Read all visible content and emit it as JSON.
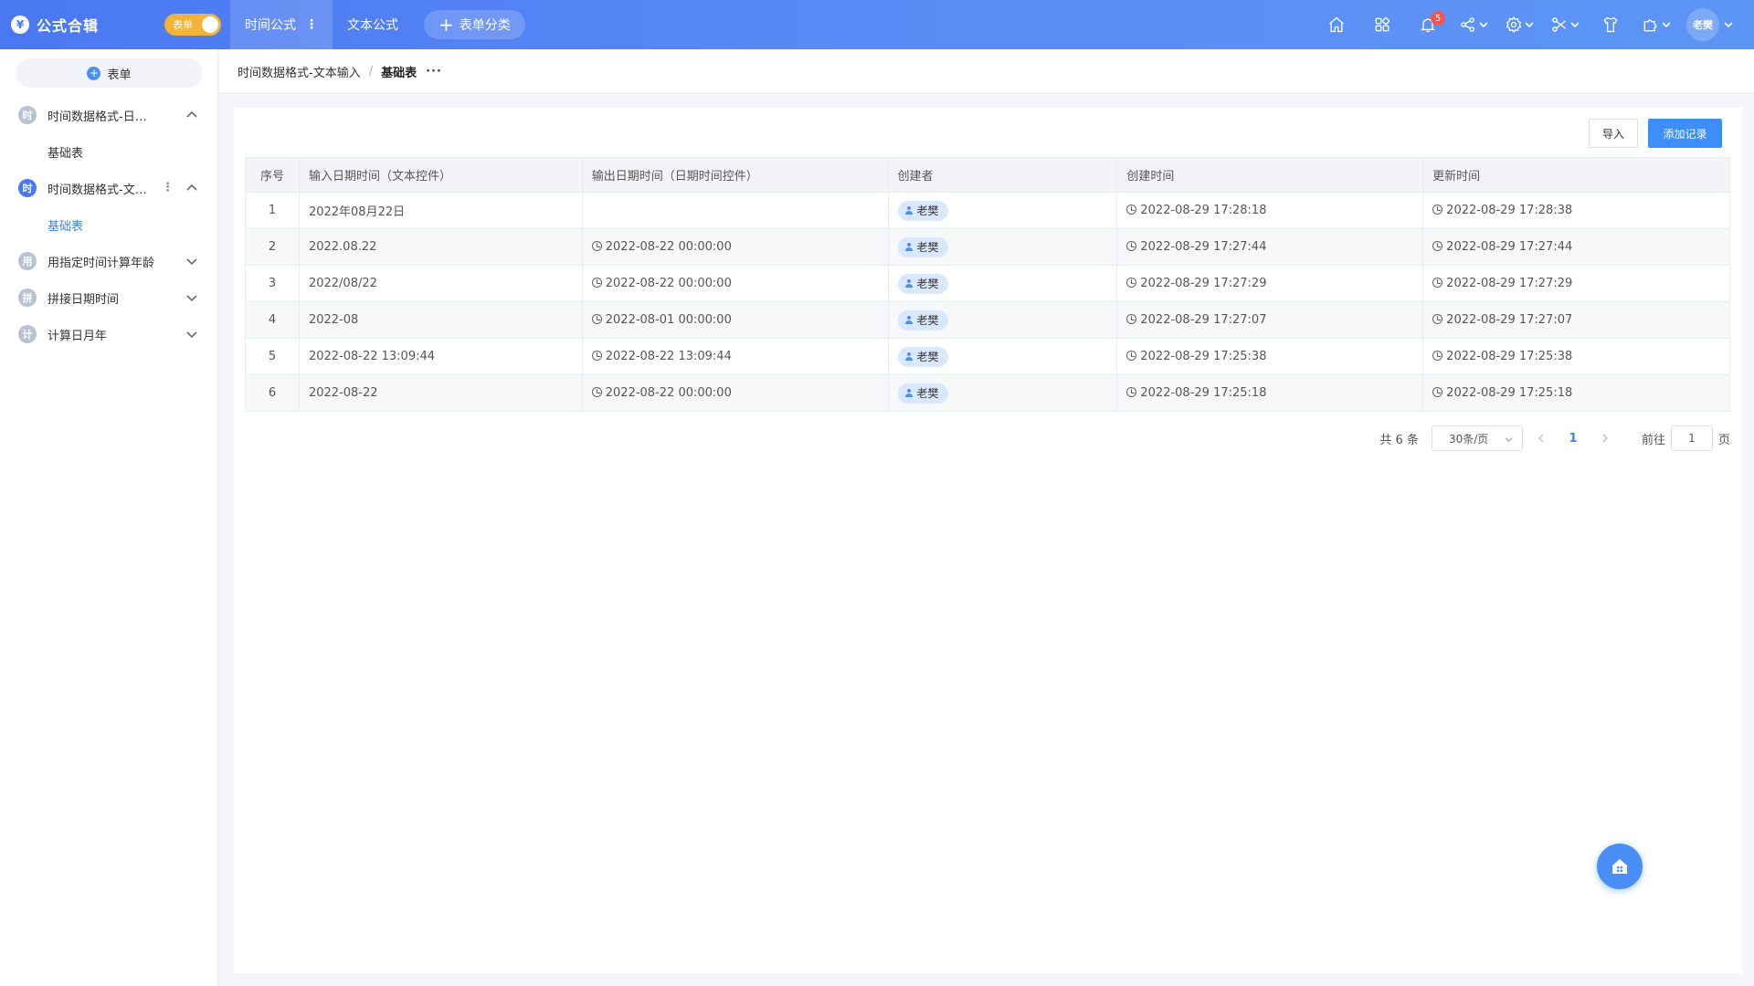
{
  "app": {
    "logo_glyph": "¥",
    "title": "公式合辑",
    "toggle_label": "表单"
  },
  "top_tabs": [
    {
      "label": "时间公式"
    },
    {
      "label": "文本公式"
    }
  ],
  "add_category_label": "表单分类",
  "notification_count": "5",
  "user_name": "老樊",
  "sidebar": {
    "add_label": "表单",
    "groups": [
      {
        "icon_text": "时",
        "label": "时间数据格式-日期控件",
        "expanded": true,
        "sub": "基础表"
      },
      {
        "icon_text": "时",
        "label": "时间数据格式-文本输入",
        "expanded": true,
        "sub": "基础表"
      },
      {
        "icon_text": "用",
        "label": "用指定时间计算年龄",
        "expanded": false
      },
      {
        "icon_text": "拼",
        "label": "拼接日期时间",
        "expanded": false
      },
      {
        "icon_text": "计",
        "label": "计算日月年",
        "expanded": false
      }
    ]
  },
  "breadcrumb": {
    "parent": "时间数据格式-文本输入",
    "sep": "/",
    "current": "基础表",
    "more": "···"
  },
  "toolbar": {
    "import_label": "导入",
    "add_label": "添加记录"
  },
  "table": {
    "headers": [
      "序号",
      "输入日期时间（文本控件）",
      "输出日期时间（日期时间控件）",
      "创建者",
      "创建时间",
      "更新时间"
    ],
    "rows": [
      {
        "idx": "1",
        "input": "2022年08月22日",
        "output": "",
        "creator": "老樊",
        "created": "2022-08-29 17:28:18",
        "updated": "2022-08-29 17:28:38"
      },
      {
        "idx": "2",
        "input": "2022.08.22",
        "output": "2022-08-22 00:00:00",
        "creator": "老樊",
        "created": "2022-08-29 17:27:44",
        "updated": "2022-08-29 17:27:44"
      },
      {
        "idx": "3",
        "input": "2022/08/22",
        "output": "2022-08-22 00:00:00",
        "creator": "老樊",
        "created": "2022-08-29 17:27:29",
        "updated": "2022-08-29 17:27:29"
      },
      {
        "idx": "4",
        "input": "2022-08",
        "output": "2022-08-01 00:00:00",
        "creator": "老樊",
        "created": "2022-08-29 17:27:07",
        "updated": "2022-08-29 17:27:07"
      },
      {
        "idx": "5",
        "input": "2022-08-22 13:09:44",
        "output": "2022-08-22 13:09:44",
        "creator": "老樊",
        "created": "2022-08-29 17:25:38",
        "updated": "2022-08-29 17:25:38"
      },
      {
        "idx": "6",
        "input": "2022-08-22",
        "output": "2022-08-22 00:00:00",
        "creator": "老樊",
        "created": "2022-08-29 17:25:18",
        "updated": "2022-08-29 17:25:18"
      }
    ]
  },
  "pagination": {
    "total": "共 6 条",
    "page_size": "30条/页",
    "current_page": "1",
    "goto_label": "前往",
    "goto_value": "1",
    "page_suffix": "页"
  },
  "colors": {
    "primary": "#3d8ef8",
    "header_gradient_start": "#4a78f2",
    "toggle": "#f5b335",
    "badge": "#f5534f"
  },
  "icons": [
    "home-icon",
    "apps-icon",
    "bell-icon",
    "share-icon",
    "gear-icon",
    "tools-icon",
    "shirt-icon",
    "puzzle-icon",
    "house-fab-icon"
  ]
}
